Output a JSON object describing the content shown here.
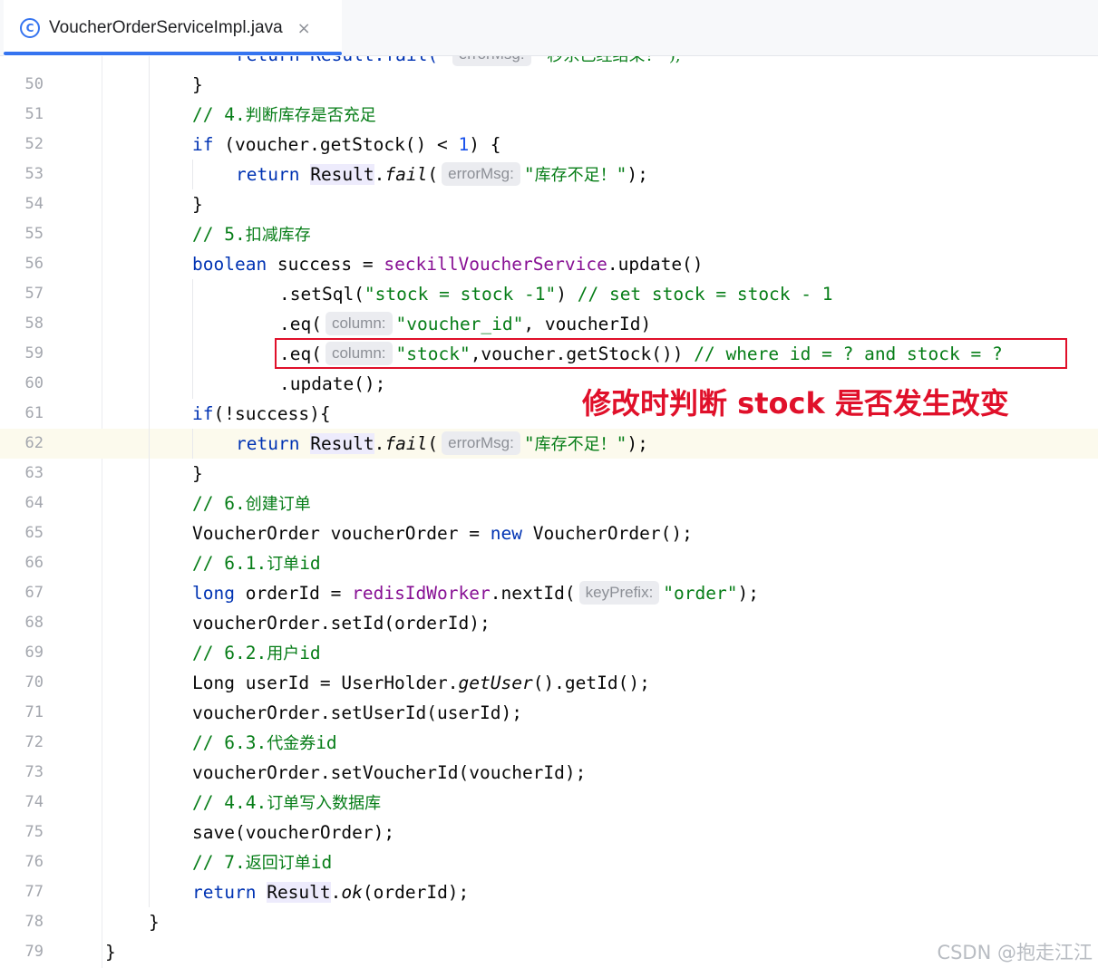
{
  "tab": {
    "title": "VoucherOrderServiceImpl.java",
    "icon": "class-icon",
    "icon_glyph": "C",
    "close_glyph": "×"
  },
  "annotation": {
    "text": "修改时判断 stock 是否发生改变",
    "color": "#e0102a"
  },
  "watermark": "CSDN @抱走江江",
  "colors": {
    "keyword": "#0033b3",
    "comment": "#067d17",
    "string": "#067d17",
    "number": "#1750eb",
    "field": "#871094",
    "accent": "#3574f0"
  },
  "editor": {
    "partial_top_line": [
      {
        "t": "return Result.fail( ",
        "c": "kw"
      },
      {
        "t": "errorMsg:",
        "c": "hint"
      },
      {
        "t": " \"秒杀已经结束！\");",
        "c": "strz"
      }
    ],
    "lines": [
      {
        "n": "50",
        "tokens": [
          {
            "t": "}"
          }
        ]
      },
      {
        "n": "51",
        "tokens": [
          {
            "t": "// 4.",
            "c": "cm"
          },
          {
            "t": "判断库存是否充足",
            "c": "cmz"
          }
        ]
      },
      {
        "n": "52",
        "tokens": [
          {
            "t": "if",
            "c": "kw"
          },
          {
            "t": " (voucher.getStock() < "
          },
          {
            "t": "1",
            "c": "num"
          },
          {
            "t": ") {"
          }
        ]
      },
      {
        "n": "53",
        "tokens": [
          {
            "t": "return",
            "c": "kw"
          },
          {
            "t": " "
          },
          {
            "t": "Result",
            "c": "cls"
          },
          {
            "t": "."
          },
          {
            "t": "fail",
            "c": "it"
          },
          {
            "t": "("
          },
          {
            "t": "errorMsg:",
            "c": "hint"
          },
          {
            "t": "\"",
            "c": "str"
          },
          {
            "t": "库存不足！",
            "c": "strz"
          },
          {
            "t": "\"",
            "c": "str"
          },
          {
            "t": ");"
          }
        ]
      },
      {
        "n": "54",
        "tokens": [
          {
            "t": "}"
          }
        ]
      },
      {
        "n": "55",
        "tokens": [
          {
            "t": "// 5.",
            "c": "cm"
          },
          {
            "t": "扣减库存",
            "c": "cmz"
          }
        ]
      },
      {
        "n": "56",
        "tokens": [
          {
            "t": "boolean",
            "c": "kw"
          },
          {
            "t": " success = "
          },
          {
            "t": "seckillVoucherService",
            "c": "fld"
          },
          {
            "t": ".update()"
          }
        ]
      },
      {
        "n": "57",
        "tokens": [
          {
            "t": ".setSql("
          },
          {
            "t": "\"stock = stock -1\"",
            "c": "str"
          },
          {
            "t": ") "
          },
          {
            "t": "// set stock = stock - 1",
            "c": "cm"
          }
        ]
      },
      {
        "n": "58",
        "tokens": [
          {
            "t": ".eq("
          },
          {
            "t": "column:",
            "c": "hint"
          },
          {
            "t": "\"voucher_id\"",
            "c": "str"
          },
          {
            "t": ", voucherId)"
          }
        ]
      },
      {
        "n": "59",
        "tokens": [
          {
            "t": ".eq("
          },
          {
            "t": "column:",
            "c": "hint"
          },
          {
            "t": "\"stock\"",
            "c": "str"
          },
          {
            "t": ",voucher.getStock()) "
          },
          {
            "t": "// where id = ? and stock = ?",
            "c": "cm"
          }
        ]
      },
      {
        "n": "60",
        "tokens": [
          {
            "t": ".update();"
          }
        ]
      },
      {
        "n": "61",
        "tokens": [
          {
            "t": "if",
            "c": "kw"
          },
          {
            "t": "(!success){"
          }
        ]
      },
      {
        "n": "62",
        "current": true,
        "tokens": [
          {
            "t": "return",
            "c": "kw"
          },
          {
            "t": " "
          },
          {
            "t": "Result",
            "c": "cls"
          },
          {
            "t": "."
          },
          {
            "t": "fail",
            "c": "it"
          },
          {
            "t": "("
          },
          {
            "t": "errorMsg:",
            "c": "hint"
          },
          {
            "t": "\"",
            "c": "str"
          },
          {
            "t": "库存不足！",
            "c": "strz"
          },
          {
            "t": "\"",
            "c": "str"
          },
          {
            "t": ");"
          }
        ]
      },
      {
        "n": "63",
        "tokens": [
          {
            "t": "}"
          }
        ]
      },
      {
        "n": "64",
        "tokens": [
          {
            "t": "// 6.",
            "c": "cm"
          },
          {
            "t": "创建订单",
            "c": "cmz"
          }
        ]
      },
      {
        "n": "65",
        "tokens": [
          {
            "t": "VoucherOrder voucherOrder = "
          },
          {
            "t": "new",
            "c": "kw"
          },
          {
            "t": " VoucherOrder();"
          }
        ]
      },
      {
        "n": "66",
        "tokens": [
          {
            "t": "// 6.1.",
            "c": "cm"
          },
          {
            "t": "订单",
            "c": "cmz"
          },
          {
            "t": "id",
            "c": "cm"
          }
        ]
      },
      {
        "n": "67",
        "tokens": [
          {
            "t": "long",
            "c": "kw"
          },
          {
            "t": " orderId = "
          },
          {
            "t": "redisIdWorker",
            "c": "fld"
          },
          {
            "t": ".nextId("
          },
          {
            "t": "keyPrefix:",
            "c": "hint"
          },
          {
            "t": "\"order\"",
            "c": "str"
          },
          {
            "t": ");"
          }
        ]
      },
      {
        "n": "68",
        "tokens": [
          {
            "t": "voucherOrder.setId(orderId);"
          }
        ]
      },
      {
        "n": "69",
        "tokens": [
          {
            "t": "// 6.2.",
            "c": "cm"
          },
          {
            "t": "用户",
            "c": "cmz"
          },
          {
            "t": "id",
            "c": "cm"
          }
        ]
      },
      {
        "n": "70",
        "tokens": [
          {
            "t": "Long userId = UserHolder."
          },
          {
            "t": "getUser",
            "c": "it"
          },
          {
            "t": "().getId();"
          }
        ]
      },
      {
        "n": "71",
        "tokens": [
          {
            "t": "voucherOrder.setUserId(userId);"
          }
        ]
      },
      {
        "n": "72",
        "tokens": [
          {
            "t": "// 6.3.",
            "c": "cm"
          },
          {
            "t": "代金券",
            "c": "cmz"
          },
          {
            "t": "id",
            "c": "cm"
          }
        ]
      },
      {
        "n": "73",
        "tokens": [
          {
            "t": "voucherOrder.setVoucherId(voucherId);"
          }
        ]
      },
      {
        "n": "74",
        "tokens": [
          {
            "t": "// 4.4.",
            "c": "cm"
          },
          {
            "t": "订单写入数据库",
            "c": "cmz"
          }
        ]
      },
      {
        "n": "75",
        "tokens": [
          {
            "t": "save(voucherOrder);"
          }
        ]
      },
      {
        "n": "76",
        "tokens": [
          {
            "t": "// 7.",
            "c": "cm"
          },
          {
            "t": "返回订单",
            "c": "cmz"
          },
          {
            "t": "id",
            "c": "cm"
          }
        ]
      },
      {
        "n": "77",
        "tokens": [
          {
            "t": "return",
            "c": "kw"
          },
          {
            "t": " "
          },
          {
            "t": "Result",
            "c": "cls"
          },
          {
            "t": "."
          },
          {
            "t": "ok",
            "c": "it"
          },
          {
            "t": "(orderId);"
          }
        ]
      },
      {
        "n": "78",
        "tokens": [
          {
            "t": "}"
          }
        ]
      },
      {
        "n": "79",
        "tokens": [
          {
            "t": "}"
          }
        ]
      }
    ]
  }
}
